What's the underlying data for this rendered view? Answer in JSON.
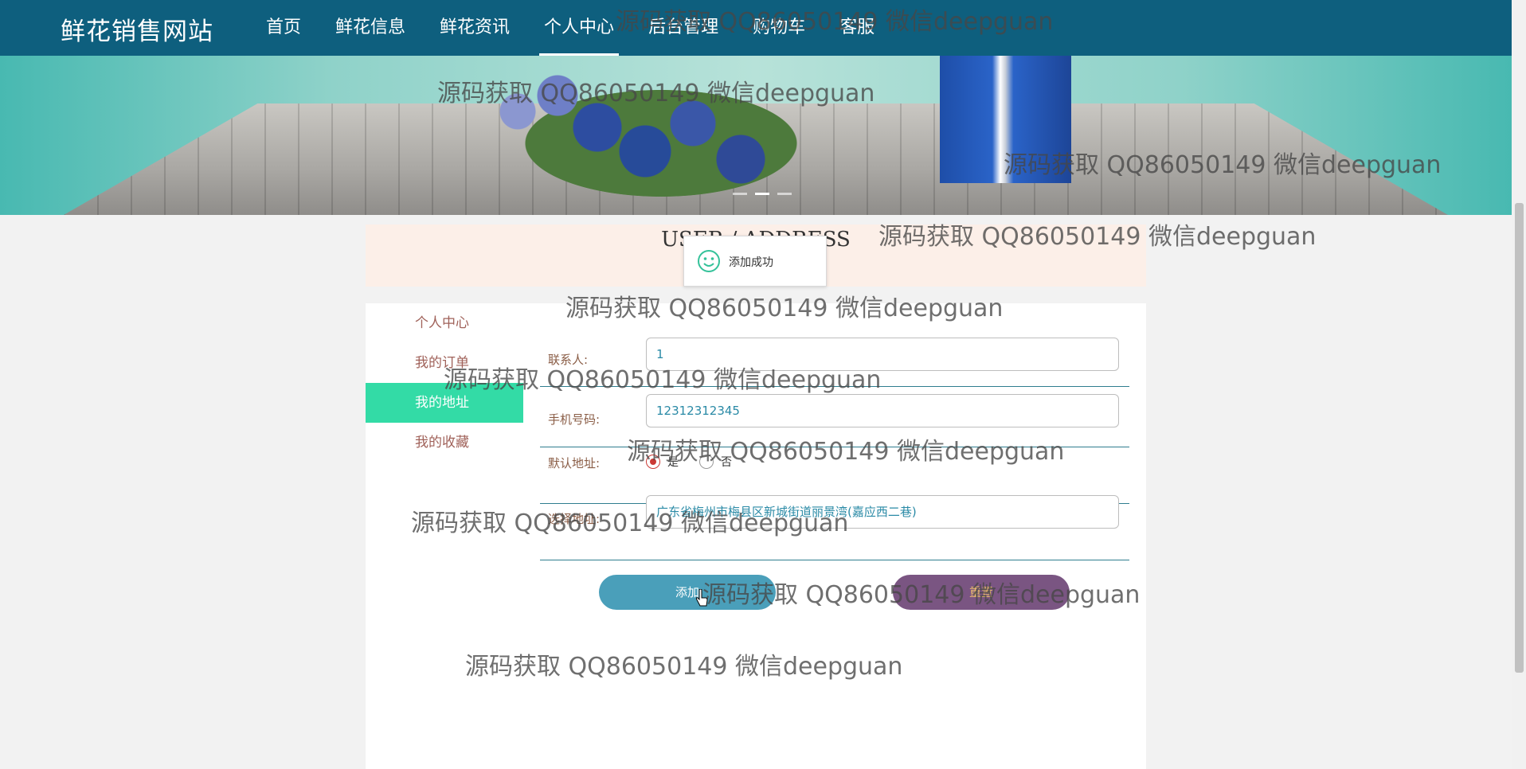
{
  "brand": "鲜花销售网站",
  "nav": [
    {
      "label": "首页",
      "active": false
    },
    {
      "label": "鲜花信息",
      "active": false
    },
    {
      "label": "鲜花资讯",
      "active": false
    },
    {
      "label": "个人中心",
      "active": true
    },
    {
      "label": "后台管理",
      "active": false
    },
    {
      "label": "购物车",
      "active": false
    },
    {
      "label": "客服",
      "active": false
    }
  ],
  "section_title": "USER / ADDRESS",
  "toast": "添加成功",
  "sidebar": [
    {
      "label": "个人中心",
      "active": false
    },
    {
      "label": "我的订单",
      "active": false
    },
    {
      "label": "我的地址",
      "active": true
    },
    {
      "label": "我的收藏",
      "active": false
    }
  ],
  "form": {
    "contact": {
      "label": "联系人:",
      "value": "1"
    },
    "phone": {
      "label": "手机号码:",
      "value": "12312312345"
    },
    "default": {
      "label": "默认地址:",
      "options": [
        "是",
        "否"
      ],
      "selected": "是"
    },
    "address": {
      "label": "选择地址:",
      "value": "广东省梅州市梅县区新城街道丽景湾(嘉应西二巷)"
    }
  },
  "buttons": {
    "add": "添加",
    "reset": "重置"
  },
  "watermark": "源码获取 QQ86050149 微信deepguan",
  "colors": {
    "nav": "#0e5f7e",
    "sidebar_active": "#33dba6",
    "add_button": "#4a9fba",
    "reset_button": "#7a5582"
  }
}
